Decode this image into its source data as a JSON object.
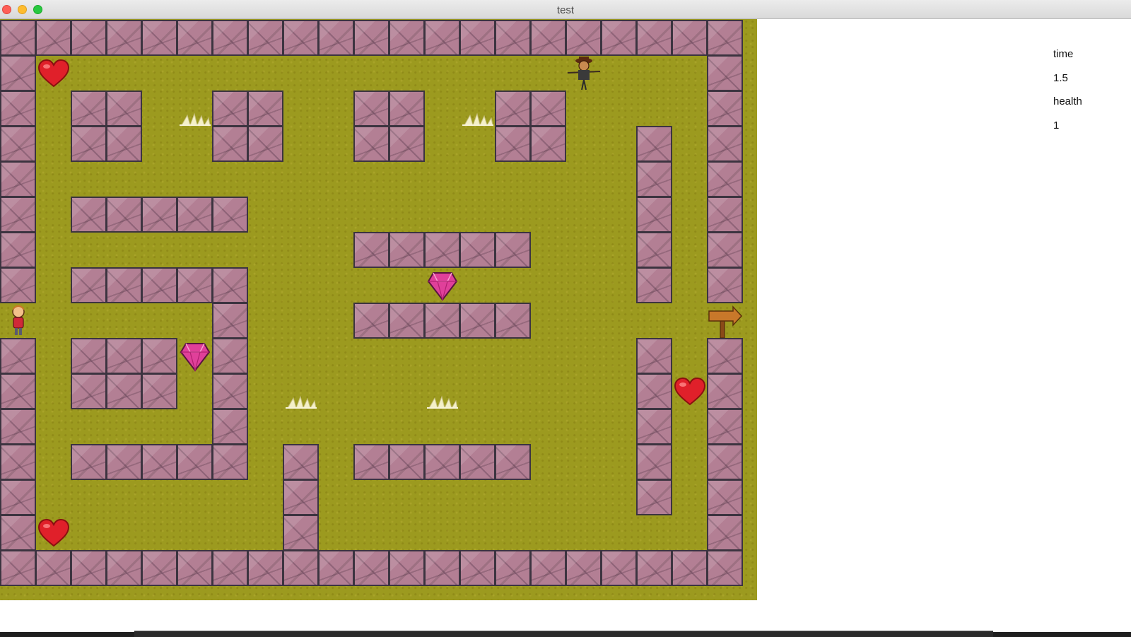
{
  "window": {
    "title": "test"
  },
  "hud": {
    "time_label": "time",
    "time_value": "1.5",
    "health_label": "health",
    "health_value": "1"
  },
  "map": {
    "cols": 21,
    "rows": 16,
    "grid": [
      "#####################",
      "#H..............E...#",
      "#.##.S##..##.S##....#",
      "#.##..##..##..##..#.#",
      "#.................#.#",
      "#.#####...........#.#",
      "#.........#####...#.#",
      "#.#####.....G.....#.#",
      "P.....#...#####.....X",
      "#.###G#...........#.#",
      "#.###.#.S...S.....#H#",
      "#.....#...........#.#",
      "#.#####.#.#####...#.#",
      "#.......#.........#.#",
      "#H......#...........#",
      "#####################"
    ],
    "legend": {
      "#": "stone-wall",
      ".": "grass",
      "H": "heart",
      "G": "gem",
      "S": "spike-trap",
      "P": "player",
      "E": "enemy",
      "X": "exit-sign"
    }
  },
  "colors": {
    "grass": "#9c9a1f",
    "wall": "#b37f94",
    "heart": "#e0202a",
    "gem": "#e0409a"
  }
}
